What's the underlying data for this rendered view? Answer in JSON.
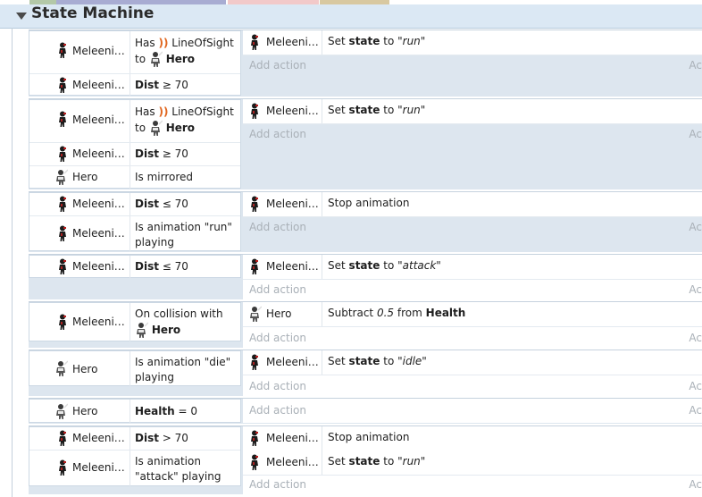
{
  "top_strip_colors": [
    "#b3c8a8",
    "#a8acd2",
    "#f2c9c9",
    "#d8c8a0"
  ],
  "group": {
    "title": "State Machine"
  },
  "labels": {
    "meleeni": "Meleeni…",
    "hero": "Hero",
    "has": "Has",
    "lineofsight": "LineOfSight",
    "to": "to",
    "dist": "Dist",
    "ge70": "≥ 70",
    "le70": "≤ 70",
    "gt70": "> 70",
    "is_mirrored": "Is mirrored",
    "is_anim_run": "Is animation \"run\"",
    "is_anim_die": "Is animation \"die\"",
    "is_anim_attack1": "Is animation",
    "is_anim_attack2": "\"attack\" playing",
    "playing": "playing",
    "on_collision": "On collision with",
    "health": "Health",
    "eq0": "= 0",
    "set": "Set",
    "state": "state",
    "to_word": "to",
    "run": "\"run\"",
    "attack": "\"attack\"",
    "idle": "\"idle\"",
    "stop_animation": "Stop animation",
    "subtract": "Subtract",
    "half": "0.5",
    "from": "from",
    "health_word": "Health",
    "add_action": "Add action",
    "add_action_right": "Ac"
  },
  "icons": {
    "sound": "sound-wave-icon",
    "melee_sprite": "meleeni-sprite-icon",
    "hero_sprite": "hero-sprite-icon",
    "arrow": "trigger-arrow-icon"
  }
}
